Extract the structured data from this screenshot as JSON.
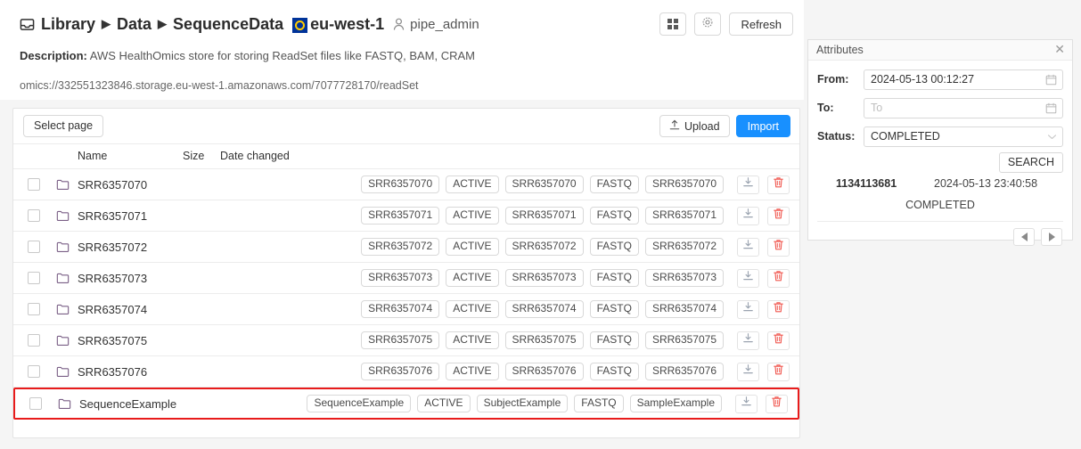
{
  "header": {
    "breadcrumb": [
      {
        "label": "Library",
        "icon": "inbox-icon"
      },
      {
        "label": "Data"
      },
      {
        "label": "SequenceData"
      }
    ],
    "separator": "▶",
    "region": "eu-west-1",
    "region_icon": "eu-flag-icon",
    "user": "pipe_admin",
    "user_icon": "user-icon",
    "description_label": "Description:",
    "description": "AWS HealthOmics store for storing ReadSet files like FASTQ, BAM, CRAM",
    "omics_url": "omics://332551323846.storage.eu-west-1.amazonaws.com/7077728170/readSet",
    "actions": {
      "grid_icon": "grid-view-icon",
      "settings_icon": "gear-icon",
      "refresh_label": "Refresh"
    }
  },
  "toolbar": {
    "select_page_label": "Select page",
    "upload_label": "Upload",
    "upload_icon": "upload-icon",
    "import_label": "Import",
    "import_color": "#1890ff"
  },
  "table": {
    "columns": [
      "Name",
      "Size",
      "Date changed"
    ],
    "rows": [
      {
        "name": "SRR6357070",
        "icon": "folder-icon",
        "tags": [
          "SRR6357070",
          "ACTIVE",
          "SRR6357070",
          "FASTQ",
          "SRR6357070"
        ],
        "highlighted": false
      },
      {
        "name": "SRR6357071",
        "icon": "folder-icon",
        "tags": [
          "SRR6357071",
          "ACTIVE",
          "SRR6357071",
          "FASTQ",
          "SRR6357071"
        ],
        "highlighted": false
      },
      {
        "name": "SRR6357072",
        "icon": "folder-icon",
        "tags": [
          "SRR6357072",
          "ACTIVE",
          "SRR6357072",
          "FASTQ",
          "SRR6357072"
        ],
        "highlighted": false
      },
      {
        "name": "SRR6357073",
        "icon": "folder-icon",
        "tags": [
          "SRR6357073",
          "ACTIVE",
          "SRR6357073",
          "FASTQ",
          "SRR6357073"
        ],
        "highlighted": false
      },
      {
        "name": "SRR6357074",
        "icon": "folder-icon",
        "tags": [
          "SRR6357074",
          "ACTIVE",
          "SRR6357074",
          "FASTQ",
          "SRR6357074"
        ],
        "highlighted": false
      },
      {
        "name": "SRR6357075",
        "icon": "folder-icon",
        "tags": [
          "SRR6357075",
          "ACTIVE",
          "SRR6357075",
          "FASTQ",
          "SRR6357075"
        ],
        "highlighted": false
      },
      {
        "name": "SRR6357076",
        "icon": "folder-icon",
        "tags": [
          "SRR6357076",
          "ACTIVE",
          "SRR6357076",
          "FASTQ",
          "SRR6357076"
        ],
        "highlighted": false
      },
      {
        "name": "SequenceExample",
        "icon": "folder-icon",
        "tags": [
          "SequenceExample",
          "ACTIVE",
          "SubjectExample",
          "FASTQ",
          "SampleExample"
        ],
        "highlighted": true
      }
    ],
    "row_actions": {
      "download_icon": "download-icon",
      "delete_icon": "trash-icon"
    },
    "highlight_color": "#e81b1b"
  },
  "attributes": {
    "title": "Attributes",
    "close_icon": "close-icon",
    "from_label": "From:",
    "from_value": "2024-05-13 00:12:27",
    "from_placeholder": "From",
    "to_label": "To:",
    "to_value": "",
    "to_placeholder": "To",
    "calendar_icon": "calendar-icon",
    "status_label": "Status:",
    "status_value": "COMPLETED",
    "status_chevron_icon": "chevron-down-icon",
    "search_label": "SEARCH",
    "result": {
      "id": "1134113681",
      "date": "2024-05-13 23:40:58",
      "status": "COMPLETED"
    },
    "pager": {
      "prev_icon": "triangle-left-icon",
      "next_icon": "triangle-right-icon"
    }
  }
}
